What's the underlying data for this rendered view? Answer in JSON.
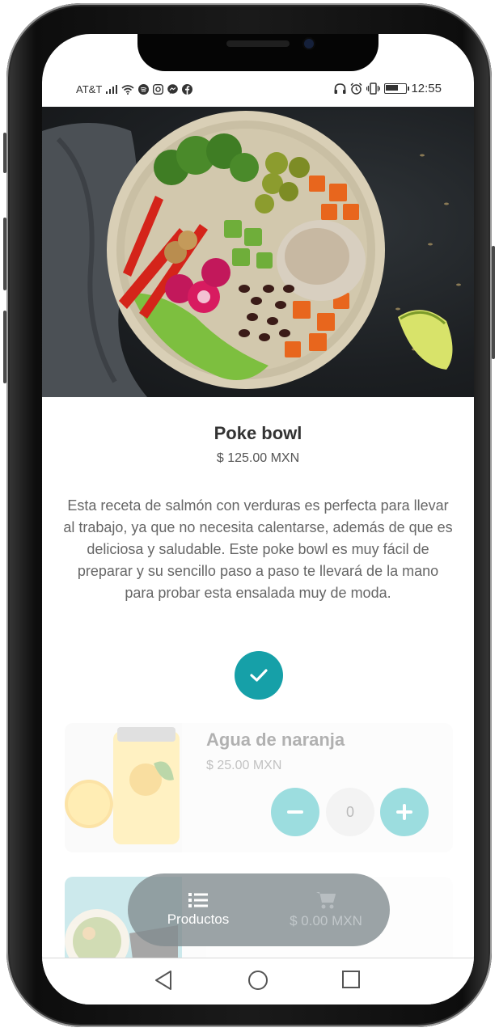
{
  "status": {
    "carrier": "AT&T",
    "time": "12:55",
    "left_icons": [
      "signal-icon",
      "wifi-icon",
      "spotify-icon",
      "instagram-icon",
      "messenger-icon",
      "facebook-icon"
    ],
    "right_icons": [
      "headphones-icon",
      "alarm-icon",
      "vibrate-icon",
      "battery-icon"
    ],
    "battery_level": 0.55
  },
  "product": {
    "name": "Poke bowl",
    "price": "$ 125.00 MXN",
    "description": "Esta receta de salmón con verduras es perfecta para llevar al trabajo, ya que no necesita calentarse, además de que es deliciosa y saludable. Este poke bowl es muy fácil de preparar y su sencillo paso a paso te llevará de la mano para probar esta ensalada muy de moda.",
    "selected_icon": "check-icon"
  },
  "list": [
    {
      "name": "Agua de naranja",
      "price": "$ 25.00 MXN",
      "quantity": "0",
      "minus_icon": "minus-icon",
      "plus_icon": "plus-icon"
    }
  ],
  "bottom_nav": {
    "products_label": "Productos",
    "cart_label": "$ 0.00 MXN",
    "products_icon": "list-icon",
    "cart_icon": "cart-icon"
  },
  "colors": {
    "accent": "#16a0a8",
    "qty_button": "#26b5b9",
    "bottom_bar": "#828c90"
  }
}
